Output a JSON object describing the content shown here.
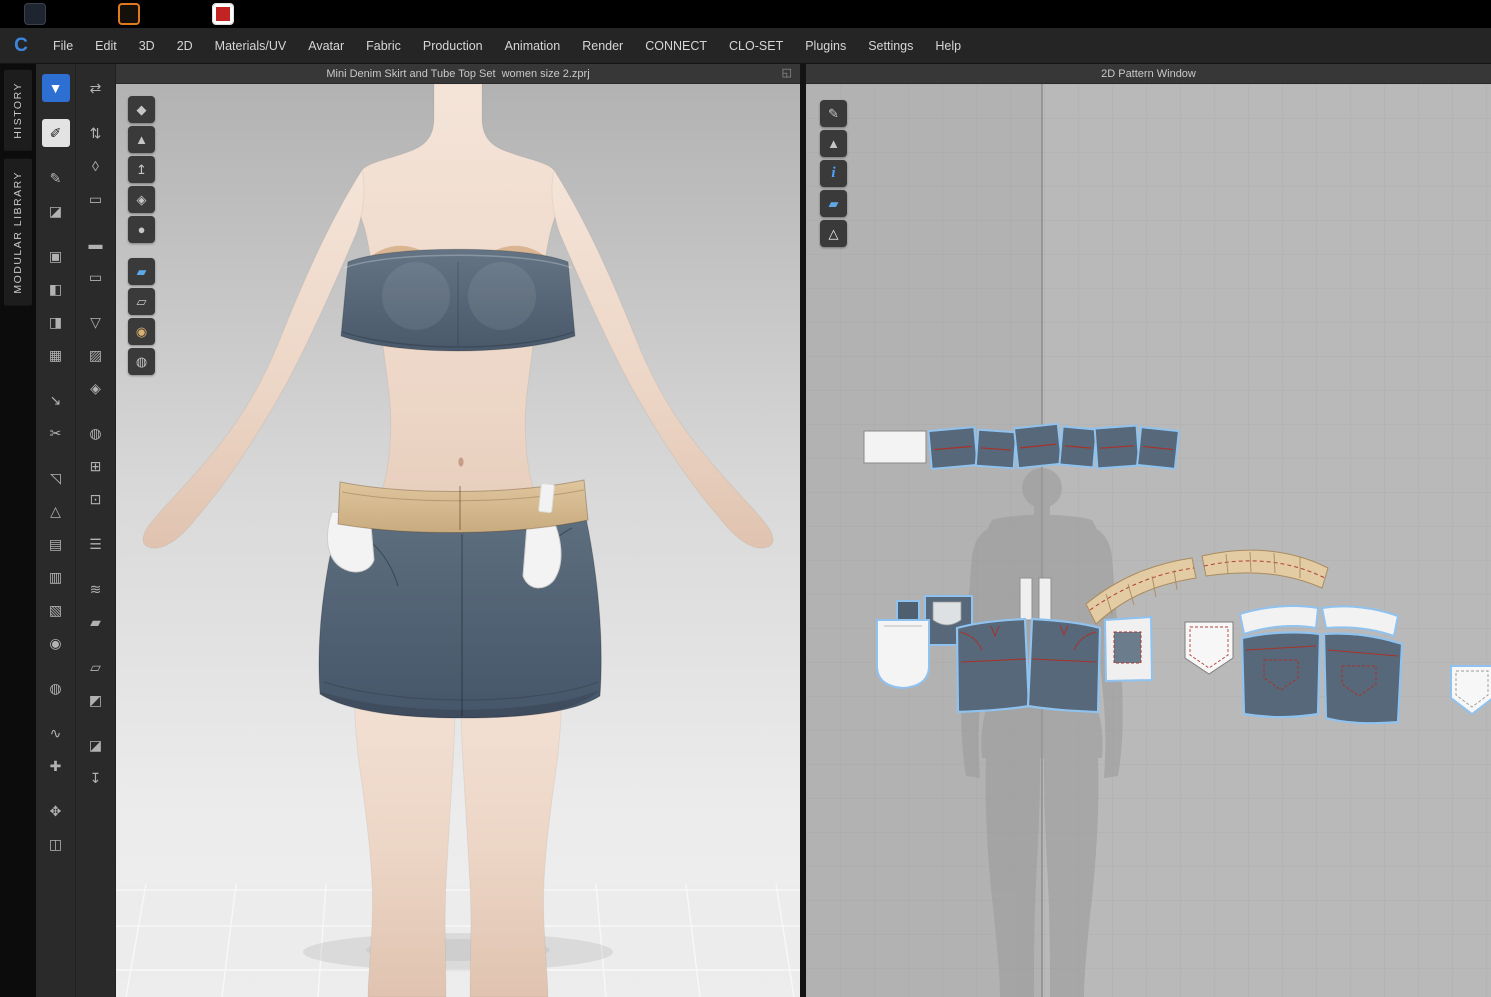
{
  "colors": {
    "accent_blue": "#2d6fd2",
    "selection_blue": "#8fc2ee",
    "denim": "#56687a",
    "waistband_tan": "#e3cba4",
    "annotation_red": "#a83228",
    "skin": "#ecd5c5",
    "viewport_bg_top": "#b3b3b3",
    "viewport_bg_bottom": "#efefef",
    "pattern_bg": "#b9b9b9"
  },
  "taskbar": {
    "icons": [
      {
        "name": "app-icon-dark",
        "variant": "dark"
      },
      {
        "name": "app-icon-orange",
        "variant": "orange"
      },
      {
        "name": "app-icon-red",
        "variant": "red"
      }
    ]
  },
  "menubar": {
    "logo_letter": "C",
    "items": [
      "File",
      "Edit",
      "3D",
      "2D",
      "Materials/UV",
      "Avatar",
      "Fabric",
      "Production",
      "Animation",
      "Render",
      "CONNECT",
      "CLO-SET",
      "Plugins",
      "Settings",
      "Help"
    ]
  },
  "side_tabs": [
    {
      "label": "HISTORY"
    },
    {
      "label": "MODULAR LIBRARY"
    }
  ],
  "toolbar_col1": [
    {
      "name": "simulate-button",
      "glyph": "▼",
      "state": "active-blue",
      "gap": true
    },
    {
      "name": "sewing-machine-tool",
      "glyph": "✐",
      "state": "active-light",
      "gap": true
    },
    {
      "name": "pen-tool",
      "glyph": "✎"
    },
    {
      "name": "iron-tool",
      "glyph": "◪",
      "gap": true
    },
    {
      "name": "window-pin-tool",
      "glyph": "▣"
    },
    {
      "name": "press-iron-tool",
      "glyph": "◧"
    },
    {
      "name": "steam-iron-tool",
      "glyph": "◨"
    },
    {
      "name": "grid-arrange-tool",
      "glyph": "▦",
      "gap": true
    },
    {
      "name": "pin-tool",
      "glyph": "↘"
    },
    {
      "name": "scissors-tool",
      "glyph": "✂",
      "gap": true
    },
    {
      "name": "flatten-tool",
      "glyph": "◹"
    },
    {
      "name": "solidify-tool",
      "glyph": "△"
    },
    {
      "name": "layered-garment-tool",
      "glyph": "▤"
    },
    {
      "name": "bottoms-tool",
      "glyph": "▥"
    },
    {
      "name": "top-garment-tool",
      "glyph": "▧"
    },
    {
      "name": "fit-to-avatar-tool",
      "glyph": "◉",
      "gap": true
    },
    {
      "name": "avatar-settings-tool",
      "glyph": "◍",
      "gap": true
    },
    {
      "name": "curve-tool",
      "glyph": "∿"
    },
    {
      "name": "measure-tool",
      "glyph": "✚",
      "gap": true
    },
    {
      "name": "move-garment-tool",
      "glyph": "✥"
    },
    {
      "name": "fold-garment-tool",
      "glyph": "◫"
    }
  ],
  "toolbar_col2": [
    {
      "name": "animation-mode-tool",
      "glyph": "⇄",
      "gap": true
    },
    {
      "name": "pose-tool",
      "glyph": "⇅"
    },
    {
      "name": "arrange-points-tool",
      "glyph": "◊"
    },
    {
      "name": "tape-tool",
      "glyph": "▭",
      "gap": true
    },
    {
      "name": "tape-edit-tool",
      "glyph": "▬"
    },
    {
      "name": "attach-tape-tool",
      "glyph": "▭",
      "gap": true
    },
    {
      "name": "dart-tool",
      "glyph": "▽"
    },
    {
      "name": "texture-tool",
      "glyph": "▨"
    },
    {
      "name": "stamp-tool",
      "glyph": "◈",
      "gap": true
    },
    {
      "name": "uv-globe-tool",
      "glyph": "◍"
    },
    {
      "name": "uv-grid-tool",
      "glyph": "⊞"
    },
    {
      "name": "pin-board-tool",
      "glyph": "⊡",
      "gap": true
    },
    {
      "name": "zipper-tool",
      "glyph": "☰",
      "gap": true
    },
    {
      "name": "zipper-edit-tool",
      "glyph": "≋"
    },
    {
      "name": "fabric-swatch-tool",
      "glyph": "▰",
      "gap": true
    },
    {
      "name": "fabric-gray-tool",
      "glyph": "▱"
    },
    {
      "name": "fabric-small-tool",
      "glyph": "◩",
      "gap": true
    },
    {
      "name": "fabric-dark-tool",
      "glyph": "◪"
    },
    {
      "name": "pin-drop-tool",
      "glyph": "↧"
    }
  ],
  "viewport_3d": {
    "title": "Mini Denim Skirt and Tube Top Set  women size 2.zprj",
    "float_window_glyph": "◱",
    "float_groups": [
      [
        {
          "name": "show-3d-style-icon",
          "glyph": "◆"
        },
        {
          "name": "show-garment-icon",
          "glyph": "▲"
        },
        {
          "name": "show-seamlines-icon",
          "glyph": "↥"
        },
        {
          "name": "show-pins-icon",
          "glyph": "◈"
        },
        {
          "name": "show-avatar-icon",
          "glyph": "●"
        }
      ],
      [
        {
          "name": "fabric-thickness-icon",
          "glyph": "▰",
          "style": "blue"
        },
        {
          "name": "fabric-off-icon",
          "glyph": "▱"
        },
        {
          "name": "avatar-head-icon",
          "glyph": "◉",
          "style": "tan"
        },
        {
          "name": "environment-globe-icon",
          "glyph": "◍"
        }
      ]
    ]
  },
  "viewport_2d": {
    "title": "2D Pattern Window",
    "float_tools": [
      {
        "name": "edit-pattern-pen-icon",
        "glyph": "✎"
      },
      {
        "name": "show-garment-icon",
        "glyph": "▲"
      },
      {
        "name": "info-icon",
        "glyph": "i",
        "style": "info"
      },
      {
        "name": "fabric-view-icon",
        "glyph": "▰",
        "style": "blue"
      },
      {
        "name": "show-pattern-icon",
        "glyph": "△",
        "style": "light"
      }
    ]
  }
}
